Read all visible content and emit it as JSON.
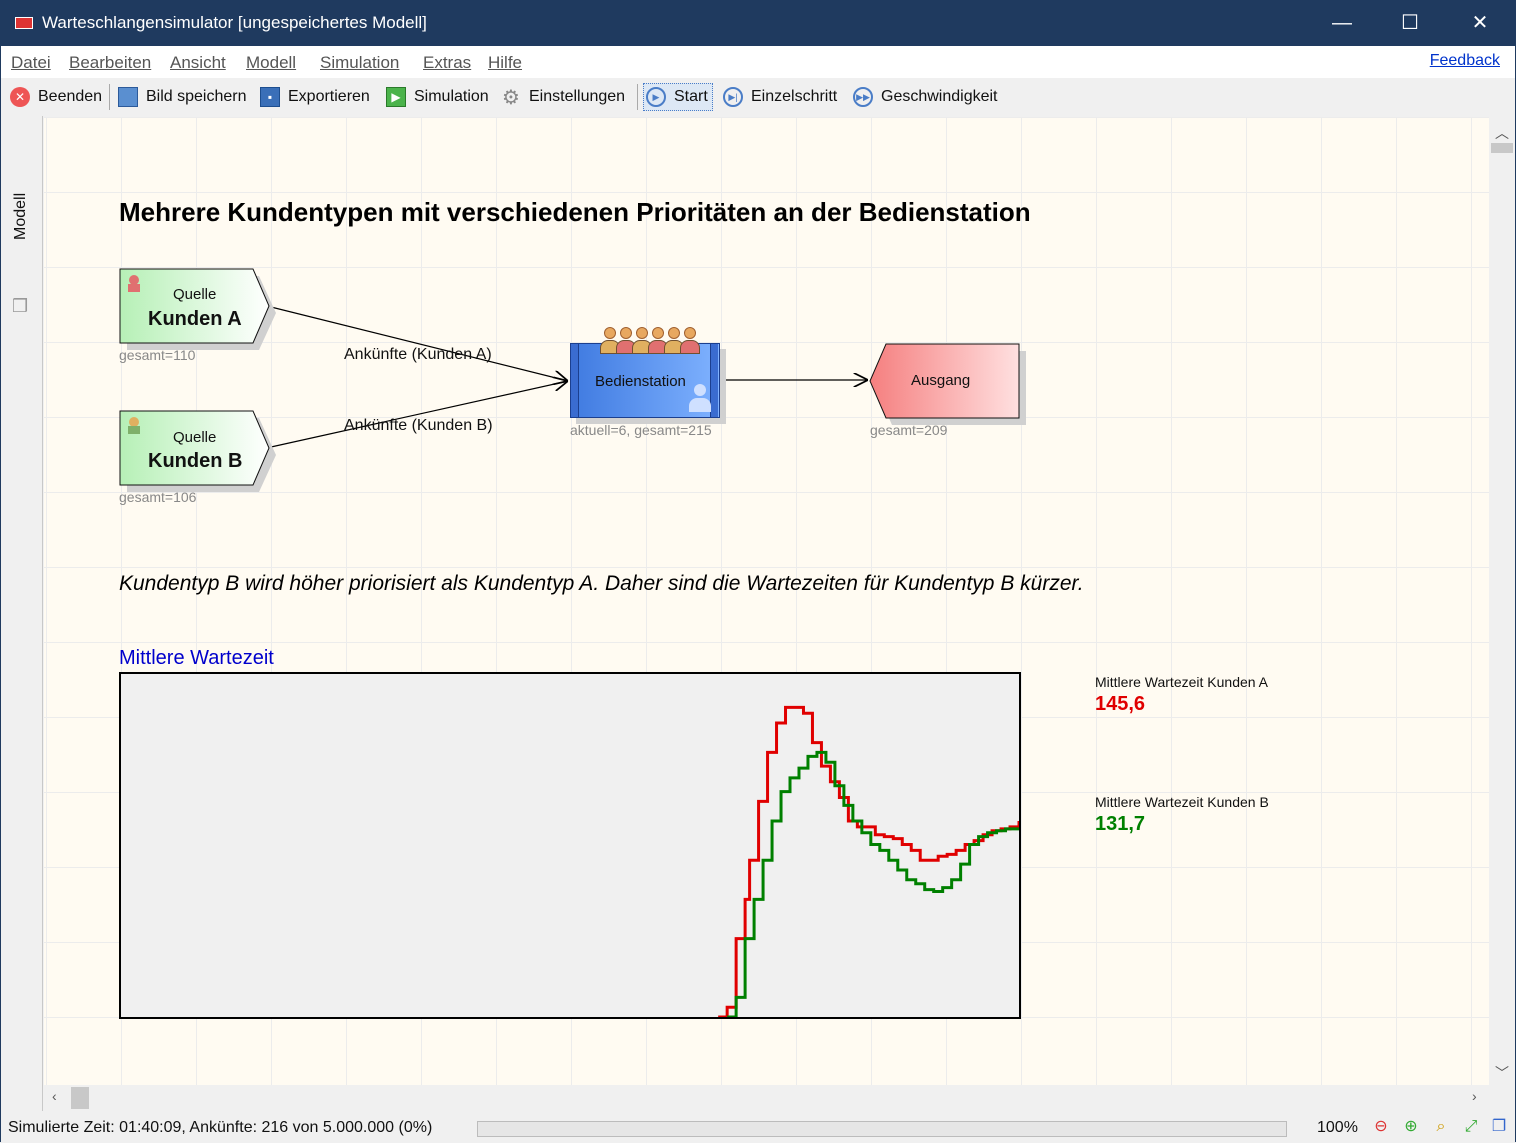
{
  "window": {
    "title": "Warteschlangensimulator [ungespeichertes Modell]",
    "minimize": "—",
    "maximize": "☐",
    "close": "✕"
  },
  "menu": {
    "items": [
      "Datei",
      "Bearbeiten",
      "Ansicht",
      "Modell",
      "Simulation",
      "Extras",
      "Hilfe"
    ],
    "feedback": "Feedback"
  },
  "toolbar": {
    "quit": "Beenden",
    "save_image": "Bild speichern",
    "export": "Exportieren",
    "simulation": "Simulation",
    "settings": "Einstellungen",
    "start": "Start",
    "single_step": "Einzelschritt",
    "speed": "Geschwindigkeit"
  },
  "sidetab": {
    "label": "Modell"
  },
  "model": {
    "heading": "Mehrere Kundentypen mit verschiedenen Prioritäten an der Bedienstation",
    "source_a": {
      "label": "Quelle",
      "name": "Kunden A",
      "counter": "gesamt=110"
    },
    "source_b": {
      "label": "Quelle",
      "name": "Kunden B",
      "counter": "gesamt=106"
    },
    "edge_a": "Ankünfte (Kunden A)",
    "edge_b": "Ankünfte (Kunden B)",
    "station": {
      "name": "Bedienstation",
      "counter": "aktuell=6, gesamt=215",
      "queue_length": 6
    },
    "exit": {
      "name": "Ausgang",
      "counter": "gesamt=209"
    },
    "description": "Kundentyp B wird höher priorisiert als Kundentyp A. Daher sind die Wartezeiten für Kundentyp B kürzer.",
    "chart_title": "Mittlere Wartezeit",
    "stat_a": {
      "label": "Mittlere Wartezeit Kunden A",
      "value": "145,6",
      "color": "#e00000"
    },
    "stat_b": {
      "label": "Mittlere Wartezeit Kunden B",
      "value": "131,7",
      "color": "#008000"
    }
  },
  "chart_data": {
    "type": "line",
    "title": "Mittlere Wartezeit",
    "xlabel": "",
    "ylabel": "",
    "grid": false,
    "xlim": [
      0,
      100
    ],
    "ylim": [
      0,
      175
    ],
    "series": [
      {
        "name": "Mittlere Wartezeit Kunden A",
        "color": "#e00000",
        "x": [
          66.5,
          67.5,
          68.5,
          69.5,
          70,
          71,
          72,
          73,
          74,
          75,
          76,
          77,
          78,
          79,
          80,
          81,
          82,
          83,
          84,
          85,
          86,
          87,
          88,
          89,
          90,
          91,
          92,
          93,
          94,
          95,
          96,
          97,
          98,
          99,
          100
        ],
        "y": [
          0,
          5,
          40,
          60,
          80,
          110,
          135,
          150,
          158,
          158,
          155,
          140,
          128,
          120,
          112,
          100,
          97,
          97,
          93,
          92,
          91,
          88,
          85,
          80,
          80,
          82,
          83,
          85,
          88,
          90,
          93,
          95,
          96,
          97,
          100
        ]
      },
      {
        "name": "Mittlere Wartezeit Kunden B",
        "color": "#008000",
        "x": [
          67.5,
          68.5,
          69.5,
          70.5,
          71.5,
          72.5,
          73.5,
          74.5,
          75.5,
          76.5,
          77.5,
          78.5,
          79.5,
          80.5,
          81.5,
          82.5,
          83.5,
          84.5,
          85.5,
          86.5,
          87.5,
          88.5,
          89.5,
          90.5,
          91.5,
          92.5,
          93.5,
          94.5,
          95.5,
          96.5,
          97.5,
          98.5,
          100
        ],
        "y": [
          0,
          10,
          40,
          60,
          80,
          100,
          115,
          122,
          127,
          133,
          135,
          130,
          118,
          108,
          100,
          94,
          88,
          85,
          80,
          75,
          70,
          68,
          65,
          64,
          66,
          70,
          78,
          88,
          92,
          94,
          95,
          96,
          96
        ]
      }
    ]
  },
  "status": {
    "text": "Simulierte Zeit: 01:40:09, Ankünfte: 216 von 5.000.000 (0%)",
    "progress": 0.0,
    "zoom": "100%"
  }
}
